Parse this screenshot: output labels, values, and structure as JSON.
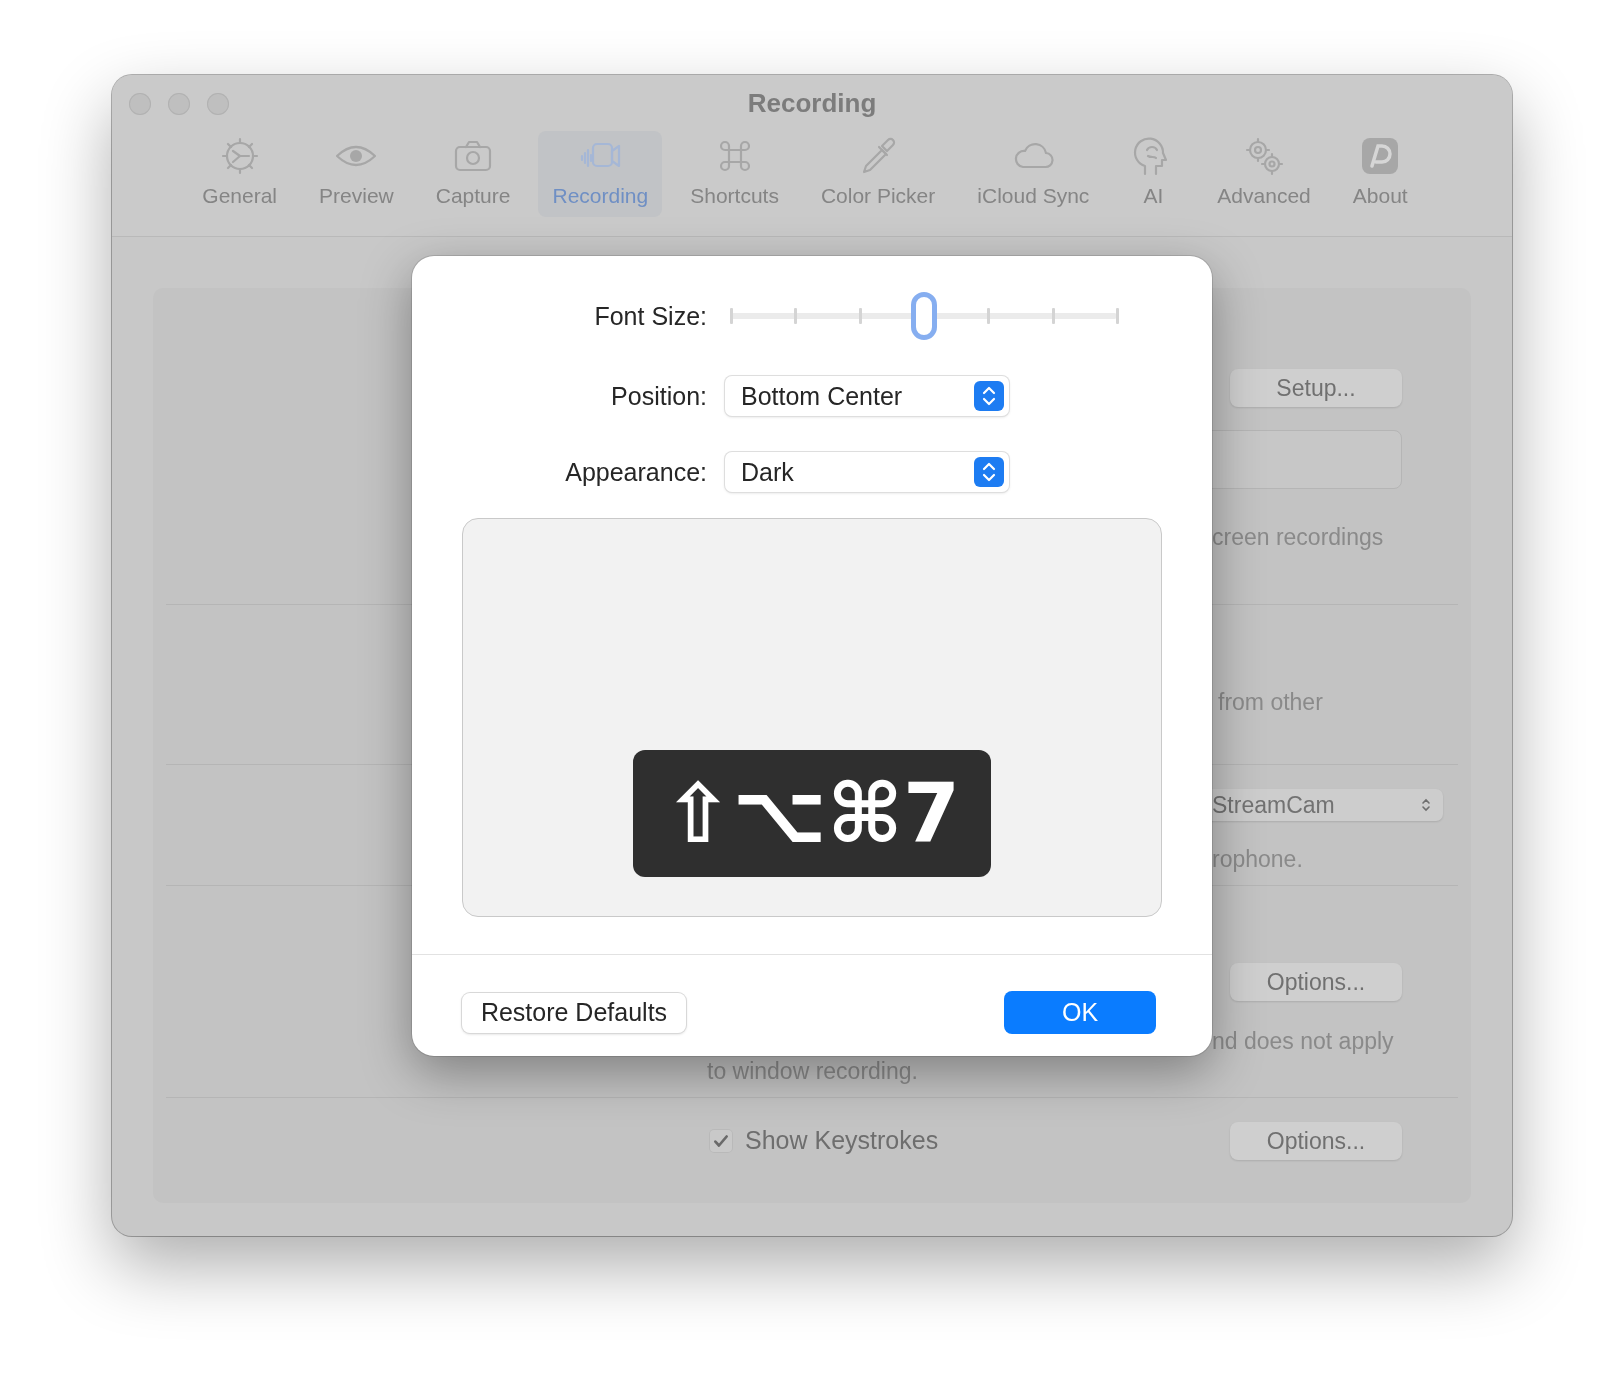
{
  "window": {
    "title": "Recording"
  },
  "toolbar": {
    "tabs": [
      {
        "label": "General",
        "selected": false
      },
      {
        "label": "Preview",
        "selected": false
      },
      {
        "label": "Capture",
        "selected": false
      },
      {
        "label": "Recording",
        "selected": true
      },
      {
        "label": "Shortcuts",
        "selected": false
      },
      {
        "label": "Color Picker",
        "selected": false
      },
      {
        "label": "iCloud Sync",
        "selected": false
      },
      {
        "label": "AI",
        "selected": false
      },
      {
        "label": "Advanced",
        "selected": false
      },
      {
        "label": "About",
        "selected": false
      }
    ]
  },
  "settings_rows": [
    {
      "kind": "button_field",
      "button": "Setup...",
      "note": "creen recordings"
    },
    {
      "kind": "note",
      "note": "from other"
    },
    {
      "kind": "popup",
      "value": "StreamCam",
      "note": "rophone."
    },
    {
      "kind": "button_note",
      "button": "Options...",
      "note": "nd does not apply",
      "note_continued": "to window recording."
    },
    {
      "kind": "checkbox",
      "label": "Show Keystrokes",
      "checked": true,
      "button": "Options..."
    }
  ],
  "keystroke_sheet": {
    "font_size": {
      "label": "Font Size:",
      "level": 0.5
    },
    "position": {
      "label": "Position:",
      "value": "Bottom Center"
    },
    "appearance": {
      "label": "Appearance:",
      "value": "Dark"
    },
    "preview": {
      "keys": "⇧⌥⌘7"
    },
    "buttons": [
      {
        "label": "Restore Defaults",
        "kind": "secondary"
      },
      {
        "label": "OK",
        "kind": "default"
      }
    ]
  }
}
